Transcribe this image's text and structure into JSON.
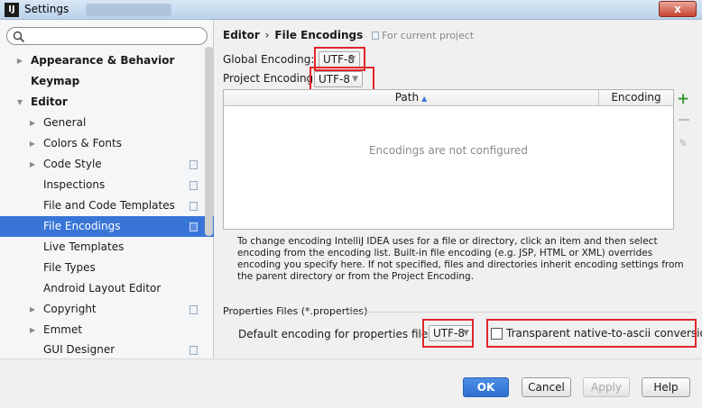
{
  "window": {
    "title": "Settings",
    "app_icon": "IJ",
    "close_label": "x"
  },
  "sidebar": {
    "search_placeholder": "",
    "items": [
      {
        "label": "Appearance & Behavior",
        "arrow": "▶"
      },
      {
        "label": "Keymap",
        "arrow": ""
      },
      {
        "label": "Editor",
        "arrow": "▼"
      },
      {
        "label": "General",
        "arrow": "▶"
      },
      {
        "label": "Colors & Fonts",
        "arrow": "▶"
      },
      {
        "label": "Code Style",
        "arrow": "▶"
      },
      {
        "label": "Inspections",
        "arrow": ""
      },
      {
        "label": "File and Code Templates",
        "arrow": ""
      },
      {
        "label": "File Encodings",
        "arrow": ""
      },
      {
        "label": "Live Templates",
        "arrow": ""
      },
      {
        "label": "File Types",
        "arrow": ""
      },
      {
        "label": "Android Layout Editor",
        "arrow": ""
      },
      {
        "label": "Copyright",
        "arrow": "▶"
      },
      {
        "label": "Emmet",
        "arrow": "▶"
      },
      {
        "label": "GUI Designer",
        "arrow": ""
      }
    ]
  },
  "main": {
    "breadcrumb": {
      "section": "Editor",
      "separator": "›",
      "page": "File Encodings",
      "scope": "For current project"
    },
    "global_encoding": {
      "label": "Global Encoding:",
      "value": "UTF-8"
    },
    "project_encoding": {
      "label": "Project Encoding:",
      "value": "UTF-8"
    },
    "table": {
      "columns": [
        "Path",
        "Encoding"
      ],
      "sort_indicator": "▲",
      "empty_text": "Encodings are not configured"
    },
    "description": "To change encoding IntelliJ IDEA uses for a file or directory, click an item and then select encoding from the encoding list. Built-in file encoding (e.g. JSP, HTML or XML) overrides encoding you specify here. If not specified, files and directories inherit encoding settings from the parent directory or from the Project Encoding.",
    "properties": {
      "section_title": "Properties Files (*.properties)",
      "default_label": "Default encoding for properties files:",
      "default_value": "UTF-8",
      "transparent_label": "Transparent native-to-ascii conversion",
      "transparent_checked": false
    }
  },
  "footer": {
    "ok": "OK",
    "cancel": "Cancel",
    "apply": "Apply",
    "help": "Help"
  },
  "colors": {
    "selection": "#3875d7",
    "highlight_box": "#e3242b",
    "ok_button": "#2f6fcf"
  }
}
